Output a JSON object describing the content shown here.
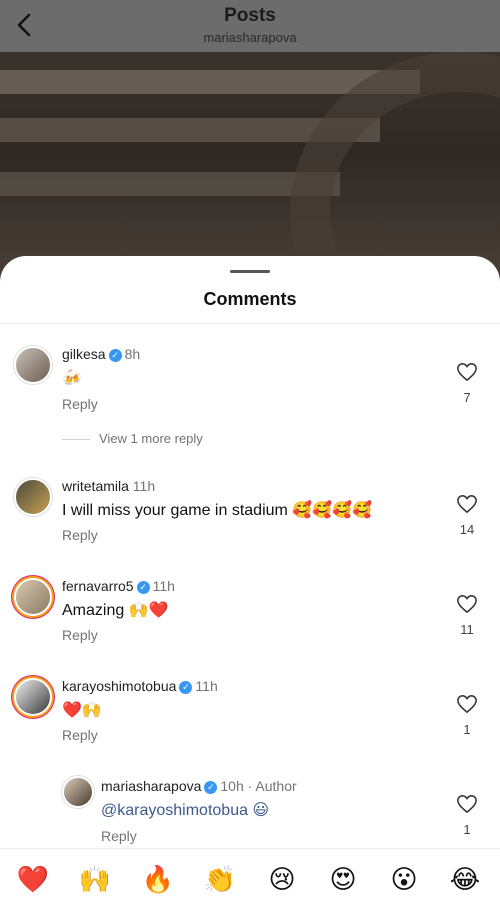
{
  "header": {
    "title": "Posts",
    "username": "mariasharapova"
  },
  "comments_sheet": {
    "title": "Comments"
  },
  "comments": [
    {
      "username": "gilkesa",
      "verified": true,
      "time": "8h",
      "text": "🍻",
      "reply_label": "Reply",
      "likes": "7",
      "view_more": "View 1 more reply"
    },
    {
      "username": "writetamila",
      "verified": false,
      "time": "11h",
      "text": "I will miss your game in stadium 🥰🥰🥰🥰",
      "reply_label": "Reply",
      "likes": "14"
    },
    {
      "username": "fernavarro5",
      "verified": true,
      "time": "11h",
      "text": "Amazing 🙌❤️",
      "reply_label": "Reply",
      "likes": "11"
    },
    {
      "username": "karayoshimotobua",
      "verified": true,
      "time": "11h",
      "text": "❤️🙌",
      "reply_label": "Reply",
      "likes": "1"
    },
    {
      "username": "mariasharapova",
      "verified": true,
      "time": "10h",
      "author_tag": "Author",
      "text": "@karayoshimotobua 😃",
      "reply_label": "Reply",
      "likes": "1"
    }
  ],
  "quick_reactions": [
    "❤️",
    "🙌",
    "🔥",
    "👏",
    "😢",
    "😍",
    "😮",
    "😂"
  ],
  "colors": {
    "link": "#3d5a8c",
    "verified": "#3897f0"
  }
}
